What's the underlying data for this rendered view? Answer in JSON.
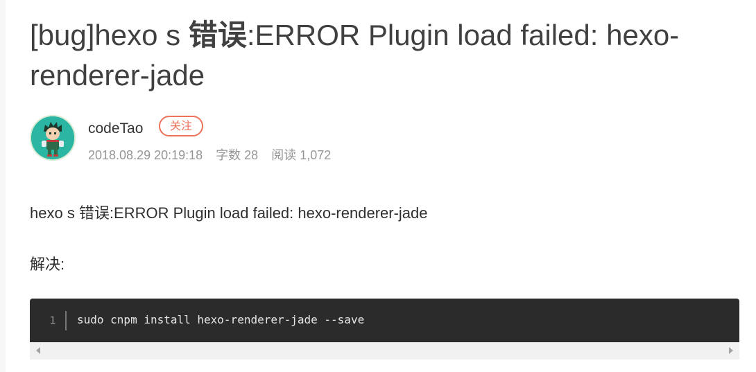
{
  "article": {
    "title_prefix": "[bug]hexo s ",
    "title_bold": "错误",
    "title_suffix": ":ERROR Plugin load failed: hexo-renderer-jade",
    "author": {
      "name": "codeTao",
      "follow_label": "关注",
      "date": "2018.08.29 20:19:18",
      "word_count": "字数 28",
      "reads": "阅读 1,072"
    },
    "paragraphs": [
      "hexo s 错误:ERROR Plugin load failed: hexo-renderer-jade",
      "解决:"
    ],
    "code": {
      "line_number": "1",
      "line": "sudo cnpm install hexo-renderer-jade --save"
    }
  },
  "colors": {
    "title": "#404040",
    "follow_accent": "#ec7259",
    "meta": "#969696",
    "code_bg": "#2b2b2b",
    "avatar_bg": "#2ab6a3"
  },
  "icons": [
    "avatar-image",
    "scroll-left-arrow-icon",
    "scroll-right-arrow-icon"
  ]
}
